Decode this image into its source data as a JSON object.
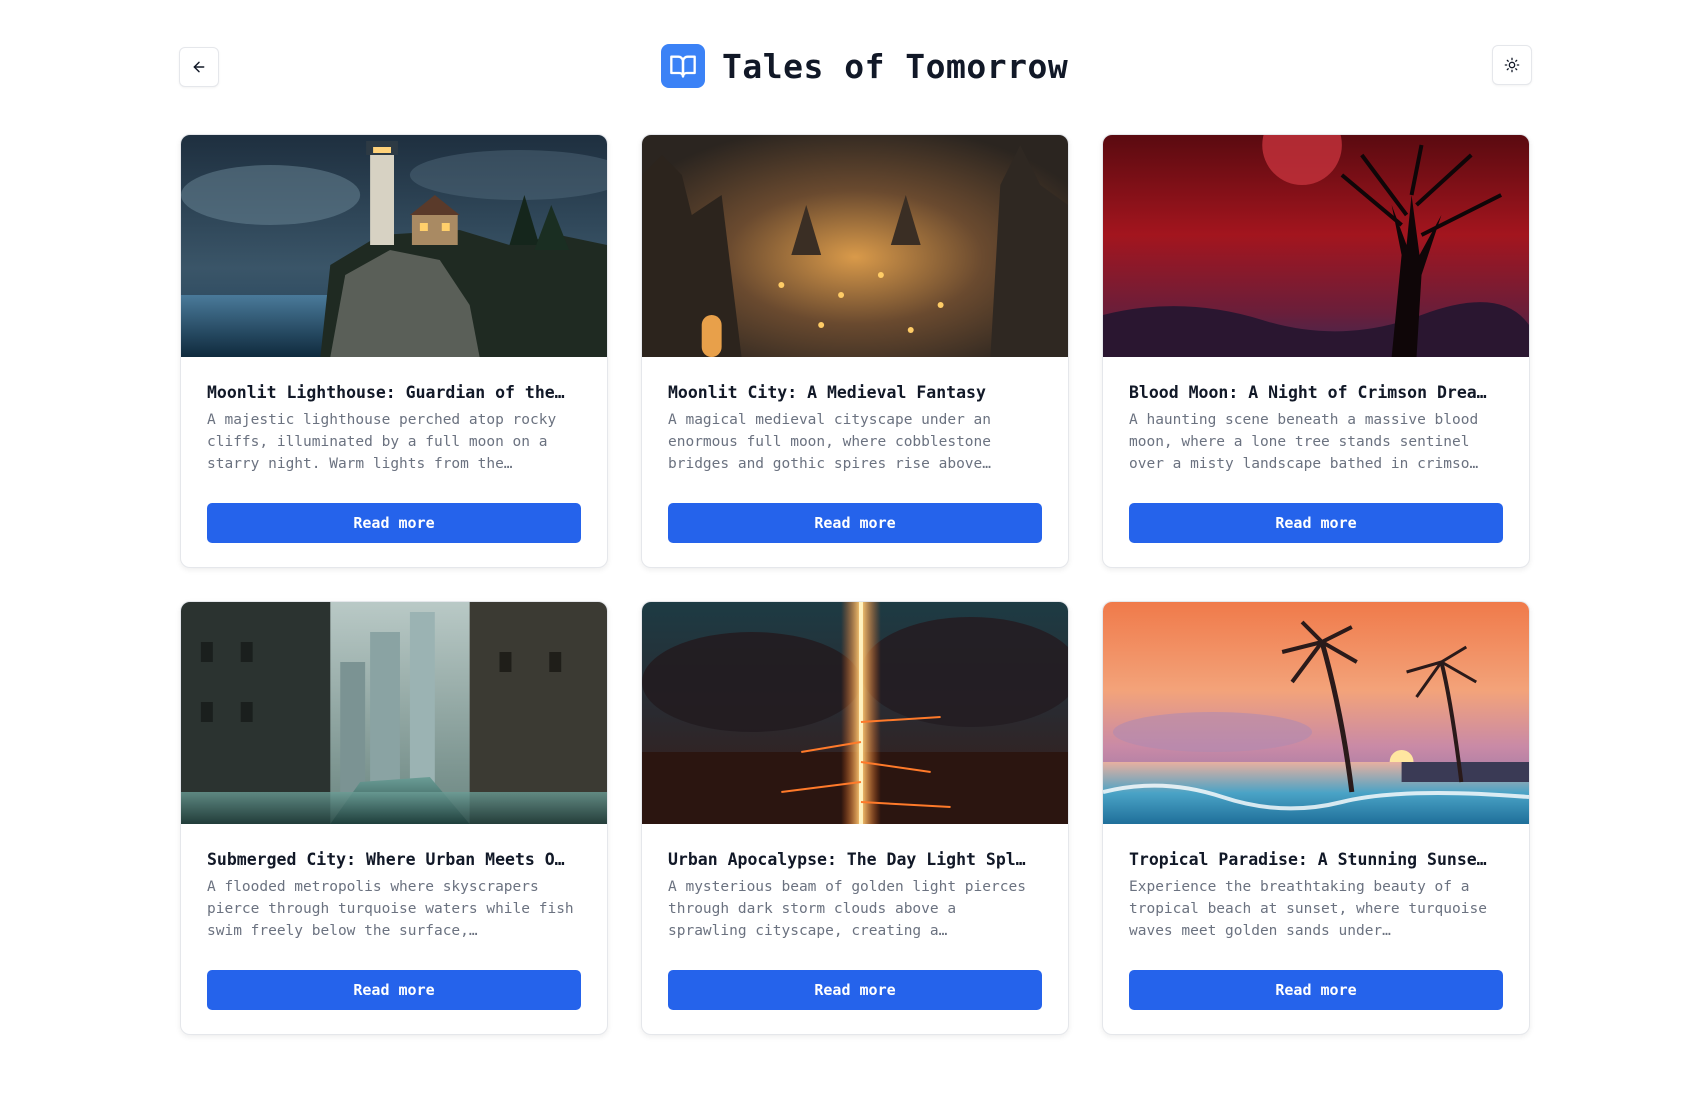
{
  "header": {
    "title": "Tales of Tomorrow",
    "back_icon": "arrow-left-icon",
    "logo_icon": "book-open-icon",
    "theme_icon": "sun-icon",
    "accent": "#3b82f6"
  },
  "button_color": "#2563eb",
  "stories": [
    {
      "title": "Moonlit Lighthouse: Guardian of the…",
      "description": "A majestic lighthouse perched atop rocky cliffs, illuminated by a full moon on a starry night. Warm lights from the…",
      "button_label": "Read more"
    },
    {
      "title": "Moonlit City: A Medieval Fantasy",
      "description": "A magical medieval cityscape under an enormous full moon, where cobblestone bridges and gothic spires rise above…",
      "button_label": "Read more"
    },
    {
      "title": "Blood Moon: A Night of Crimson Drea…",
      "description": "A haunting scene beneath a massive blood moon, where a lone tree stands sentinel over a misty landscape bathed in crimso…",
      "button_label": "Read more"
    },
    {
      "title": "Submerged City: Where Urban Meets O…",
      "description": "A flooded metropolis where skyscrapers pierce through turquoise waters while fish swim freely below the surface,…",
      "button_label": "Read more"
    },
    {
      "title": "Urban Apocalypse: The Day Light Spl…",
      "description": "A mysterious beam of golden light pierces through dark storm clouds above a sprawling cityscape, creating a…",
      "button_label": "Read more"
    },
    {
      "title": "Tropical Paradise: A Stunning Sunse…",
      "description": "Experience the breathtaking beauty of a tropical beach at sunset, where turquoise waves meet golden sands under…",
      "button_label": "Read more"
    }
  ]
}
